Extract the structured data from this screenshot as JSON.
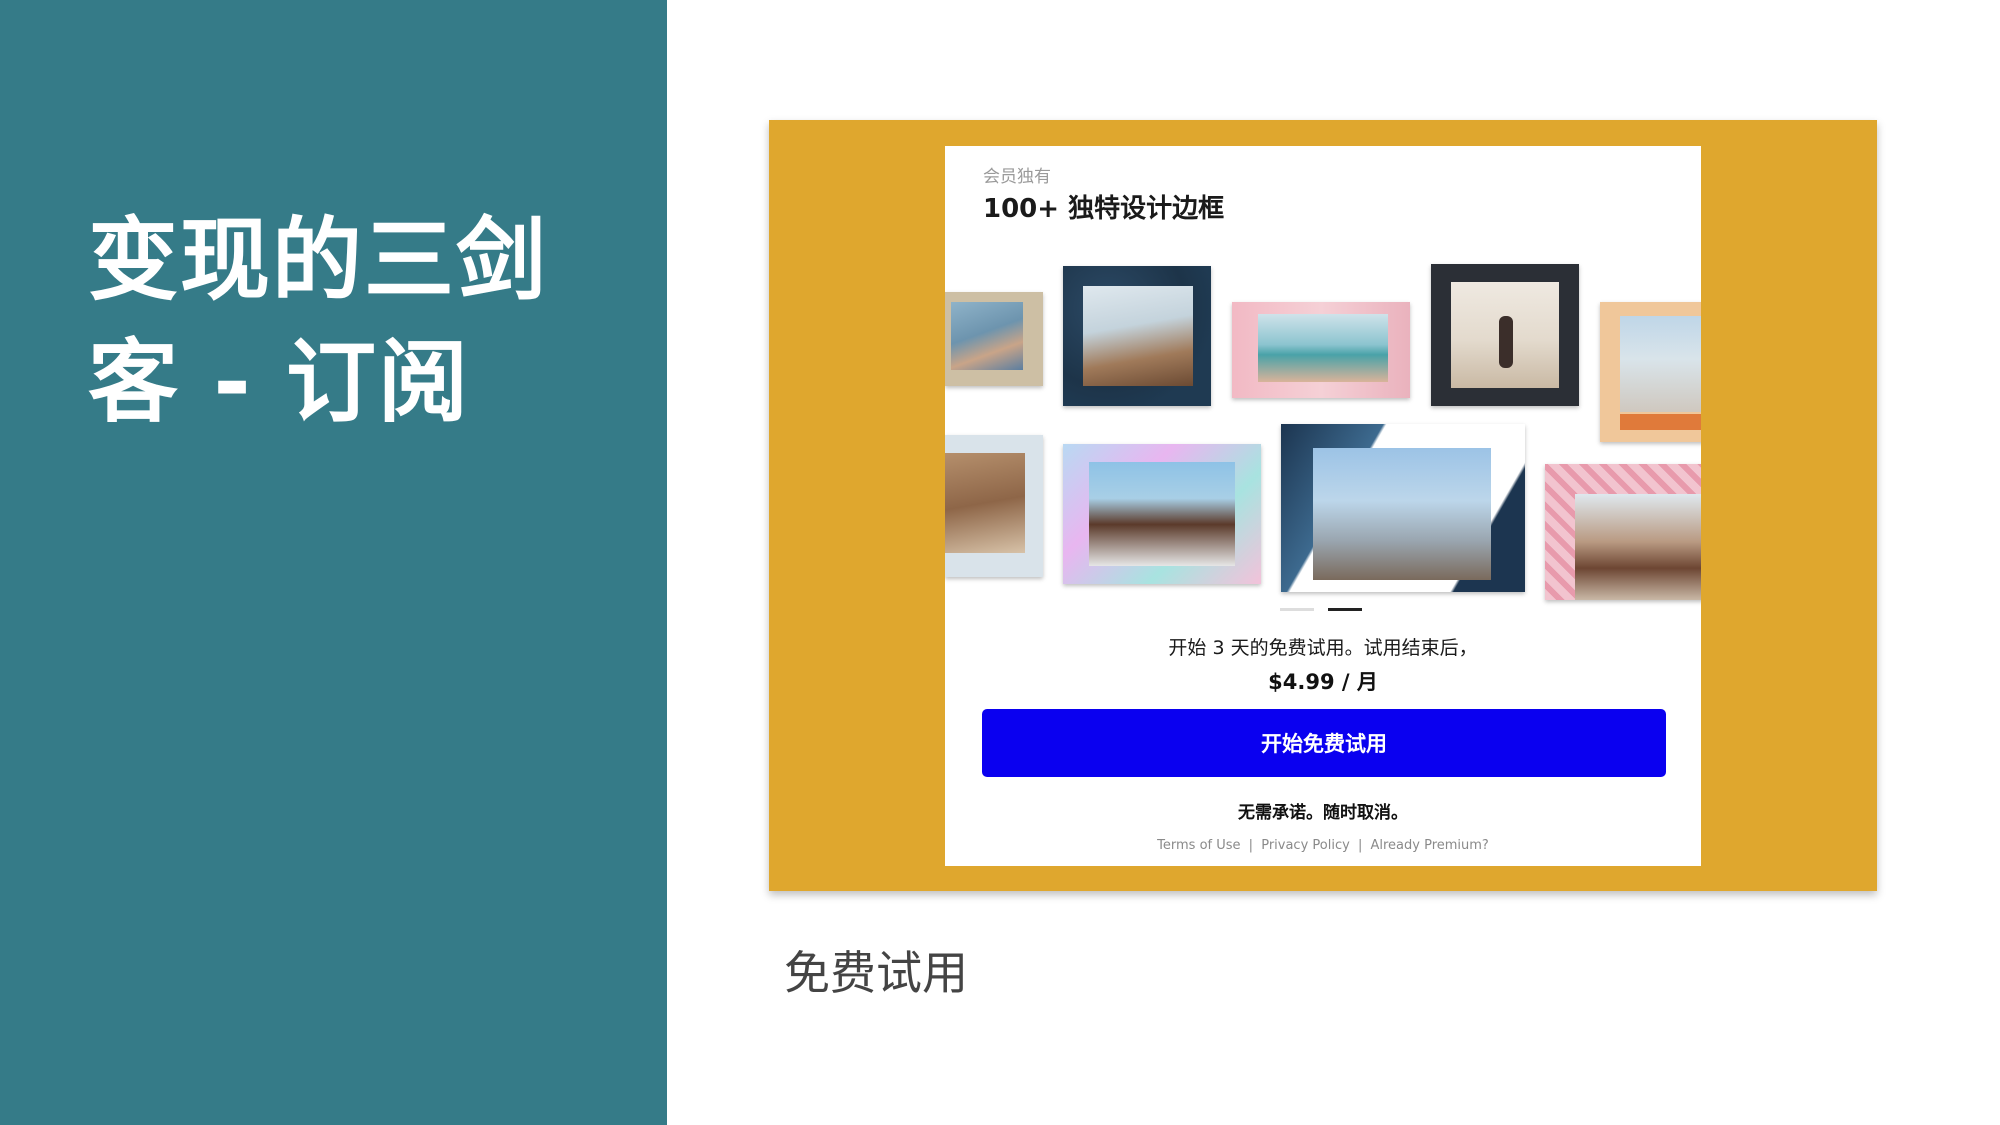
{
  "slide": {
    "title_line1": "变现的三剑",
    "title_line2": "客 - 订阅",
    "caption": "免费试用"
  },
  "screen": {
    "kicker": "会员独有",
    "headline": "100+ 独特设计边框",
    "trial_text": "开始 3 天的免费试用。试用结束后，",
    "price": "$4.99 / 月",
    "cta_label": "开始免费试用",
    "no_commitment": "无需承诺。随时取消。",
    "links": {
      "terms": "Terms of Use",
      "privacy": "Privacy Policy",
      "premium": "Already Premium?",
      "separator": "|"
    },
    "carousel": {
      "pages": 2,
      "active_index": 1
    }
  },
  "colors": {
    "left_panel": "#357b88",
    "frame": "#dfa72e",
    "cta": "#0a00f0"
  }
}
